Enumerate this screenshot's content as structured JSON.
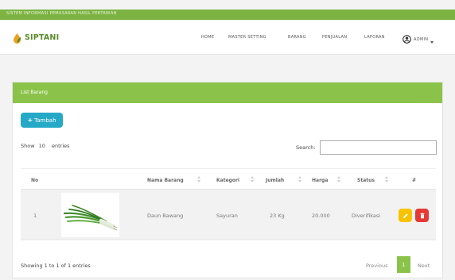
{
  "topbar": {
    "title": "SISTEM INFORMASI PEMASARAN HASIL PERTANIAN"
  },
  "brand": {
    "name": "SIPTANI",
    "logo_icon": "leaf-drop-icon",
    "color": "#5b8a2c"
  },
  "nav": {
    "items": [
      {
        "key": "home",
        "label": "HOME"
      },
      {
        "key": "master",
        "label": "MASTER SETTING"
      },
      {
        "key": "barang",
        "label": "BARANG"
      },
      {
        "key": "penjualan",
        "label": "PENJUALAN"
      },
      {
        "key": "laporan",
        "label": "LAPORAN"
      }
    ],
    "user_label": "ADMIN",
    "user_icon": "user-circle-icon"
  },
  "panel": {
    "title": "List Barang",
    "header_color": "#8bc34a",
    "add_button": "Tambah",
    "show_entries": {
      "prefix": "Show",
      "value": "10",
      "suffix": "entries"
    },
    "search_label": "Search:",
    "search_value": ""
  },
  "table": {
    "columns": [
      "No",
      "Nama Barang",
      "Kategori",
      "Jumlah",
      "Harga",
      "Status",
      "#"
    ],
    "rows": [
      {
        "no": "1",
        "image": "green-onion-photo",
        "nama": "Daun Bawang",
        "kategori": "Sayuran",
        "jumlah": "23 Kg",
        "harga": "20.000",
        "status": "Diverifikasi"
      }
    ]
  },
  "footer": {
    "info": "Showing 1 to 1 of 1 entries",
    "prev": "Previous",
    "page": "1",
    "next": "Next"
  },
  "colors": {
    "accent": "#8bc34a",
    "button": "#26a9c7",
    "edit": "#f7c300",
    "delete": "#e53935"
  }
}
